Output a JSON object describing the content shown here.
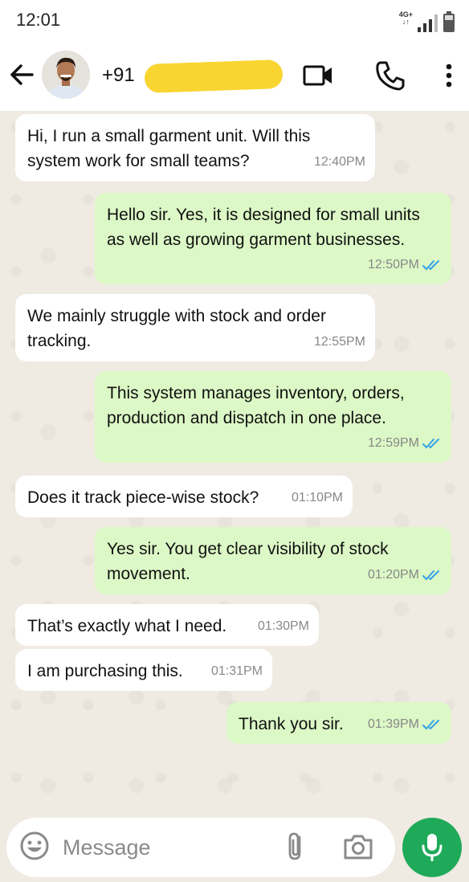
{
  "status_bar": {
    "time": "12:01",
    "network_label": "4G+"
  },
  "header": {
    "contact_name": "+91",
    "icons": [
      "back-arrow-icon",
      "avatar",
      "video-call-icon",
      "phone-icon",
      "more-vert-icon"
    ],
    "redaction_color": "#f8d531"
  },
  "messages": [
    {
      "dir": "in",
      "text": "Hi, I run a small garment unit. Will this system work for small teams?",
      "time": "12:40PM"
    },
    {
      "dir": "out",
      "text": "Hello sir. Yes, it is designed for small units as well as growing garment businesses.",
      "time": "12:50PM",
      "read": true
    },
    {
      "dir": "in",
      "text": "We mainly struggle with stock and order tracking.",
      "time": "12:55PM"
    },
    {
      "dir": "out",
      "text": "This system manages inventory, orders, production and dispatch in one place.",
      "time": "12:59PM",
      "read": true
    },
    {
      "dir": "in",
      "text": "Does it track piece-wise stock?",
      "time": "01:10PM"
    },
    {
      "dir": "out",
      "text": "Yes sir. You get clear visibility of stock movement.",
      "time": "01:20PM",
      "read": true
    },
    {
      "dir": "in",
      "text": "That’s exactly what I need.",
      "time": "01:30PM"
    },
    {
      "dir": "in",
      "text": "I am purchasing this.",
      "time": "01:31PM"
    },
    {
      "dir": "out",
      "text": "Thank you sir.",
      "time": "01:39PM",
      "read": true
    }
  ],
  "composer": {
    "placeholder": "Message",
    "value": ""
  },
  "colors": {
    "incoming_bubble": "#ffffff",
    "outgoing_bubble": "#dcf8c6",
    "chat_background": "#efeae2",
    "read_tick": "#34a3e8",
    "mic_button": "#1faa59"
  }
}
